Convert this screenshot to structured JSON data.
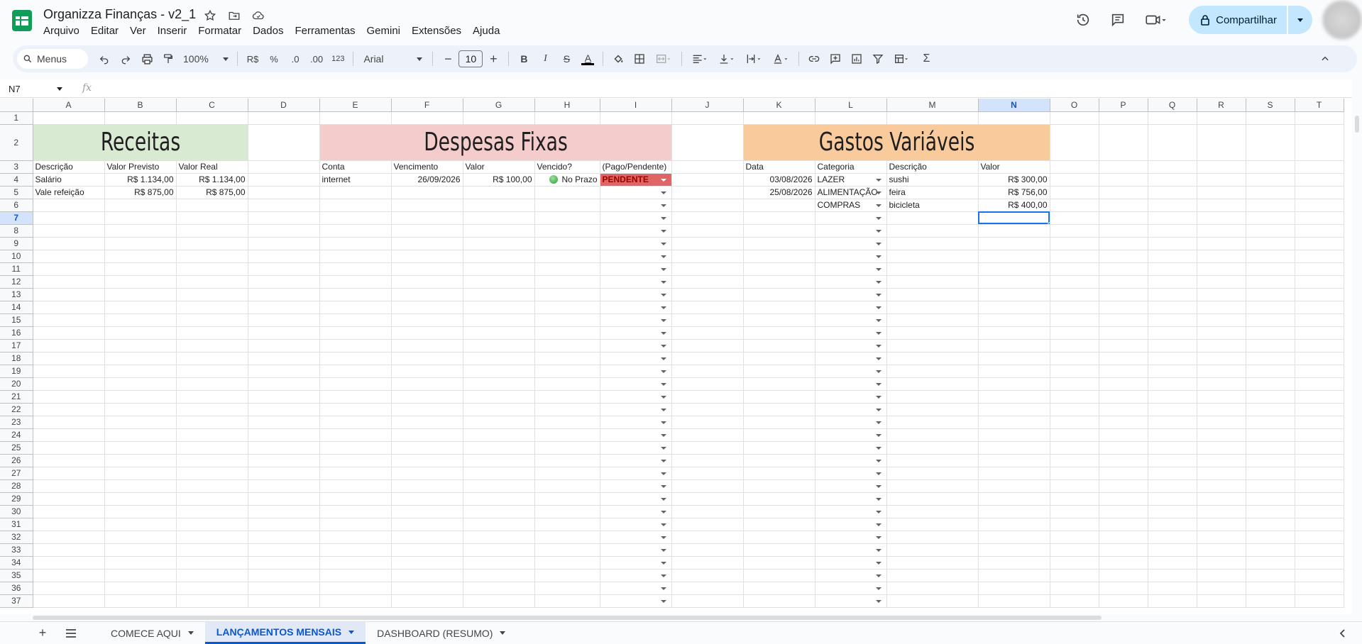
{
  "app": {
    "doc_title": "Organizza Finanças - v2_1",
    "menu": [
      "Arquivo",
      "Editar",
      "Ver",
      "Inserir",
      "Formatar",
      "Dados",
      "Ferramentas",
      "Gemini",
      "Extensões",
      "Ajuda"
    ],
    "share_label": "Compartilhar"
  },
  "toolbar": {
    "search_label": "Menus",
    "zoom": "100%",
    "currency": "R$",
    "percent": "%",
    "dec_less": ".0",
    "dec_more": ".00",
    "number_format": "123",
    "font": "Arial",
    "font_size": "10",
    "bold": "B",
    "italic": "I",
    "strike": "S",
    "text_color": "A",
    "sum": "Σ"
  },
  "formula_bar": {
    "name_box": "N7",
    "fx": "fx"
  },
  "columns": [
    "A",
    "B",
    "C",
    "D",
    "E",
    "F",
    "G",
    "H",
    "I",
    "J",
    "K",
    "L",
    "M",
    "N",
    "O",
    "P",
    "Q",
    "R",
    "S",
    "T"
  ],
  "selected_column": "N",
  "selected_row": 7,
  "row_count": 37,
  "sheet": {
    "receitas": {
      "title": "Receitas",
      "headers": [
        "Descrição",
        "Valor Previsto",
        "Valor Real"
      ],
      "rows": [
        [
          "Salário",
          "R$ 1.134,00",
          "R$ 1.134,00"
        ],
        [
          "Vale refeição",
          "R$ 875,00",
          "R$ 875,00"
        ]
      ]
    },
    "despesas": {
      "title": "Despesas Fixas",
      "headers": [
        "Conta",
        "Vencimento",
        "Valor",
        "Vencido?",
        "(Pago/Pendente)"
      ],
      "rows": [
        [
          "internet",
          "26/09/2026",
          "R$ 100,00",
          "No Prazo",
          "PENDENTE"
        ]
      ]
    },
    "gastos": {
      "title": "Gastos Variáveis",
      "headers": [
        "Data",
        "Categoria",
        "Descrição",
        "Valor"
      ],
      "rows": [
        [
          "03/08/2026",
          "LAZER",
          "sushi",
          "R$ 300,00"
        ],
        [
          "25/08/2026",
          "ALIMENTAÇÃO",
          "feira",
          "R$ 756,00"
        ],
        [
          "",
          "COMPRAS",
          "bicicleta",
          "R$ 400,00"
        ]
      ]
    }
  },
  "sheet_tabs": [
    "COMECE AQUI",
    "LANÇAMENTOS MENSAIS",
    "DASHBOARD (RESUMO)"
  ],
  "active_tab": "LANÇAMENTOS MENSAIS",
  "colors": {
    "receitas_bg": "#d9ead3",
    "despesas_bg": "#f4cccc",
    "gastos_bg": "#f9cb9c",
    "pending_bg": "#e06666",
    "accent": "#0b57d0"
  }
}
